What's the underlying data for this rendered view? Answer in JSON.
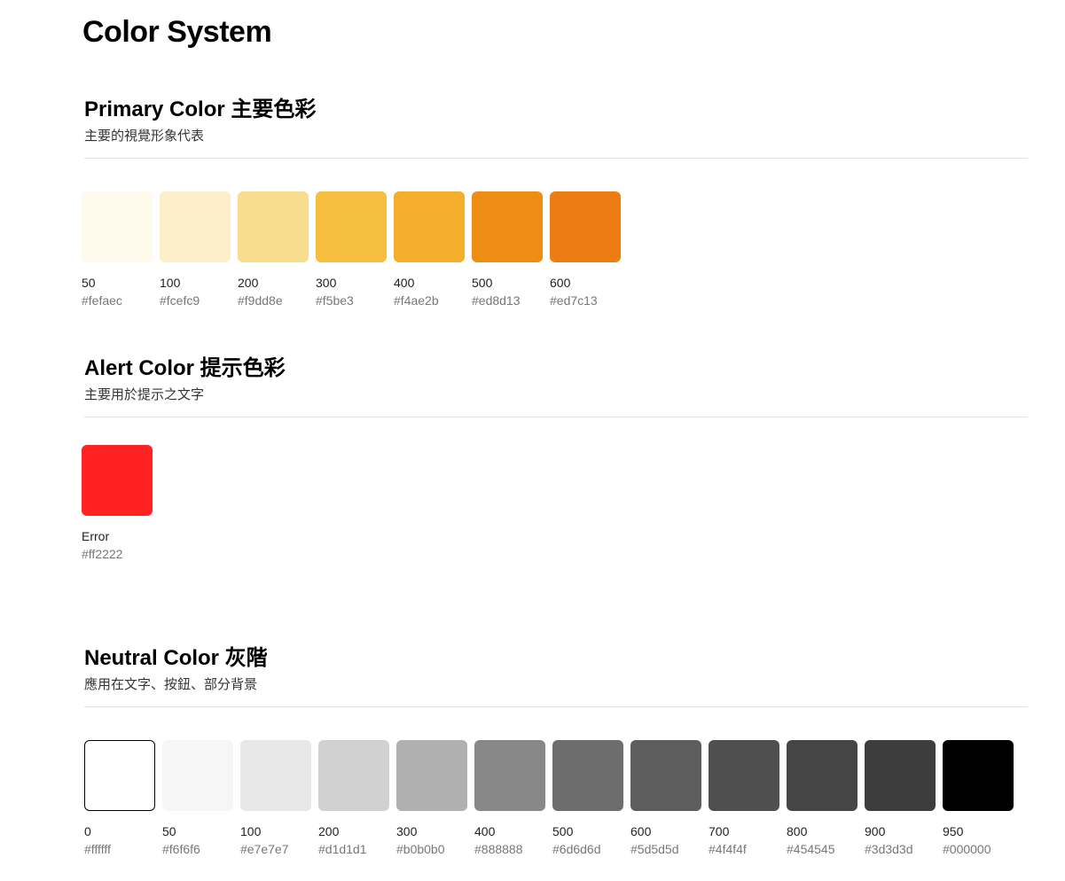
{
  "page": {
    "title": "Color System"
  },
  "primary": {
    "title": "Primary Color 主要色彩",
    "subtitle": "主要的視覺形象代表",
    "swatches": [
      {
        "label": "50",
        "hex": "#fefaec"
      },
      {
        "label": "100",
        "hex": "#fcefc9"
      },
      {
        "label": "200",
        "hex": "#f9dd8e"
      },
      {
        "label": "300",
        "hex": "#f5be3"
      },
      {
        "label": "400",
        "hex": "#f4ae2b"
      },
      {
        "label": "500",
        "hex": "#ed8d13"
      },
      {
        "label": "600",
        "hex": "#ed7c13"
      }
    ]
  },
  "alert": {
    "title": "Alert Color 提示色彩",
    "subtitle": "主要用於提示之文字",
    "swatches": [
      {
        "label": "Error",
        "hex": "#ff2222"
      }
    ]
  },
  "neutral": {
    "title": "Neutral Color 灰階",
    "subtitle": "應用在文字、按鈕、部分背景",
    "swatches": [
      {
        "label": "0",
        "hex": "#ffffff"
      },
      {
        "label": "50",
        "hex": "#f6f6f6"
      },
      {
        "label": "100",
        "hex": "#e7e7e7"
      },
      {
        "label": "200",
        "hex": "#d1d1d1"
      },
      {
        "label": "300",
        "hex": "#b0b0b0"
      },
      {
        "label": "400",
        "hex": "#888888"
      },
      {
        "label": "500",
        "hex": "#6d6d6d"
      },
      {
        "label": "600",
        "hex": "#5d5d5d"
      },
      {
        "label": "700",
        "hex": "#4f4f4f"
      },
      {
        "label": "800",
        "hex": "#454545"
      },
      {
        "label": "900",
        "hex": "#3d3d3d"
      },
      {
        "label": "950",
        "hex": "#000000"
      }
    ]
  },
  "fill_colors": {
    "primary": [
      "#fefaec",
      "#fcefc9",
      "#f9dd8e",
      "#f5be3f",
      "#f4ae2b",
      "#ed8d13",
      "#ed7c13"
    ],
    "alert": [
      "#ff2222"
    ],
    "neutral": [
      "#ffffff",
      "#f6f6f6",
      "#e7e7e7",
      "#d1d1d1",
      "#b0b0b0",
      "#888888",
      "#6d6d6d",
      "#5d5d5d",
      "#4f4f4f",
      "#454545",
      "#3d3d3d",
      "#000000"
    ]
  }
}
